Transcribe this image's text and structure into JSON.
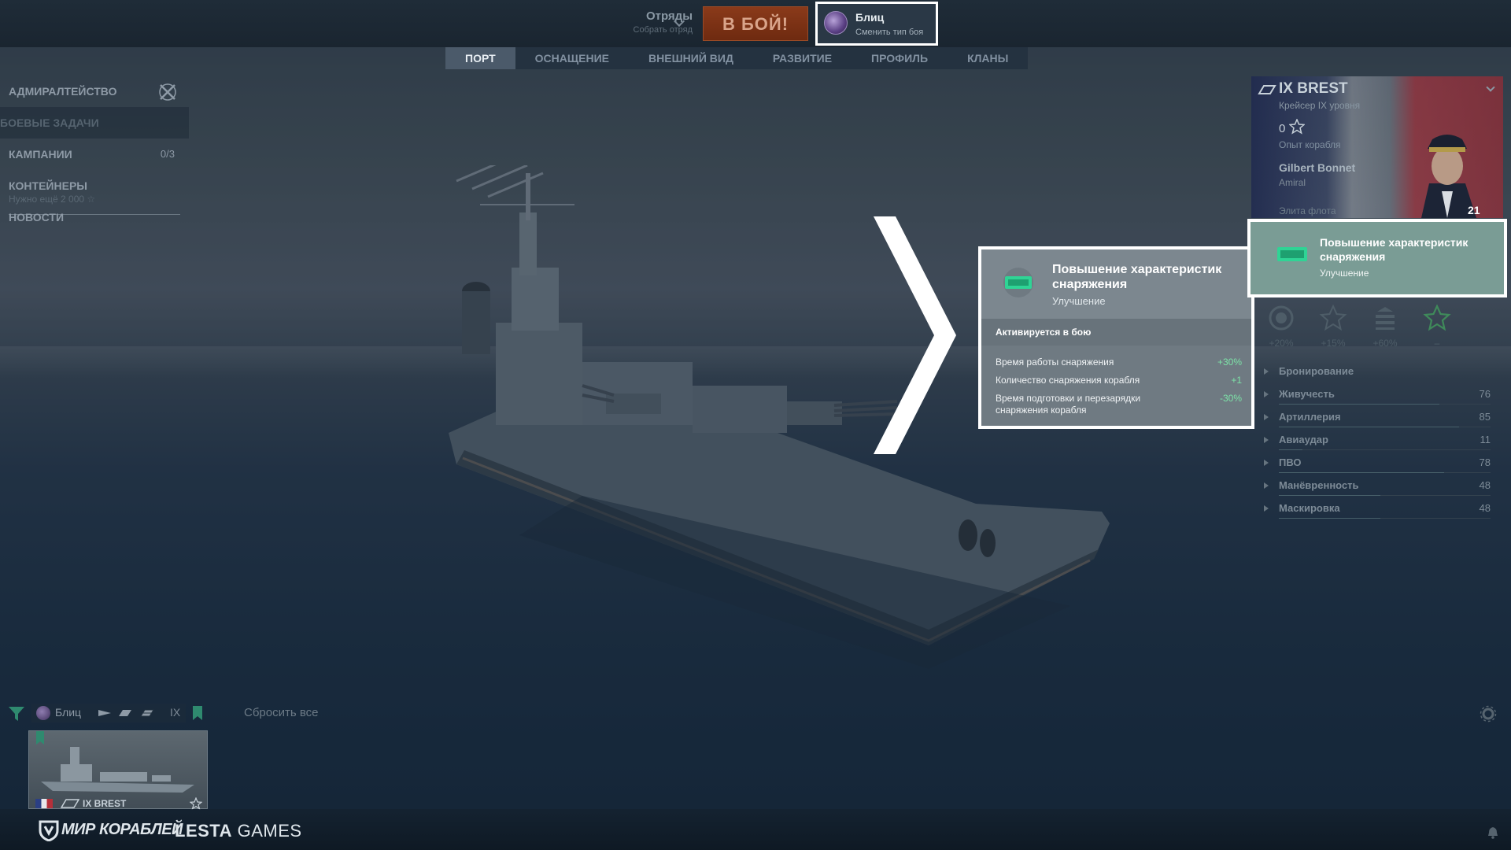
{
  "topbar": {
    "squads_title": "Отряды",
    "squads_sub": "Собрать отряд",
    "battle_button": "В БОЙ!",
    "mode_title": "Блиц",
    "mode_sub": "Сменить тип боя"
  },
  "tabs": [
    {
      "label": "ПОРТ",
      "active": true
    },
    {
      "label": "ОСНАЩЕНИЕ",
      "active": false
    },
    {
      "label": "ВНЕШНИЙ ВИД",
      "active": false
    },
    {
      "label": "РАЗВИТИЕ",
      "active": false
    },
    {
      "label": "ПРОФИЛЬ",
      "active": false
    },
    {
      "label": "КЛАНЫ",
      "active": false
    }
  ],
  "left_menu": {
    "admiralty": "АДМИРАЛТЕЙСТВО",
    "combat_missions": "БОЕВЫЕ ЗАДАЧИ",
    "campaigns": "КАМПАНИИ",
    "campaigns_count": "0/3",
    "containers": "КОНТЕЙНЕРЫ",
    "containers_sub": "Нужно ещё 2 000",
    "news": "НОВОСТИ"
  },
  "tooltip": {
    "title": "Повышение характеристик снаряжения",
    "type": "Улучшение",
    "condition": "Активируется в бою",
    "rows": [
      {
        "label": "Время работы снаряжения",
        "value": "+30%"
      },
      {
        "label": "Количество снаряжения корабля",
        "value": "+1"
      },
      {
        "label": "Время подготовки и перезарядки снаряжения корабля",
        "value": "-30%"
      }
    ]
  },
  "ship_panel": {
    "name": "IX BREST",
    "class": "Крейсер IX уровня",
    "xp": "0",
    "xp_label": "Опыт корабля",
    "commander_name": "Gilbert Bonnet",
    "commander_rank": "Amiral",
    "commander_elite": "Элита флота",
    "commander_level": "21"
  },
  "upgrade_slot": {
    "title": "Повышение характеристик снаряжения",
    "type": "Улучшение"
  },
  "bonus_slots": [
    "+20%",
    "+15%",
    "+60%",
    "–"
  ],
  "stats": [
    {
      "name": "Бронирование",
      "value": ""
    },
    {
      "name": "Живучесть",
      "value": "76"
    },
    {
      "name": "Артиллерия",
      "value": "85"
    },
    {
      "name": "Авиаудар",
      "value": "11"
    },
    {
      "name": "ПВО",
      "value": "78"
    },
    {
      "name": "Манёвренность",
      "value": "48"
    },
    {
      "name": "Маскировка",
      "value": "48"
    }
  ],
  "carousel": {
    "filter_mode": "Блиц",
    "filter_tier": "IX",
    "reset_all": "Сбросить все",
    "card_name": "IX BREST"
  },
  "footer": {
    "logo_mk": "МИР КОРАБЛЕЙ",
    "logo_lesta_a": "LESTA",
    "logo_lesta_b": "GAMES"
  },
  "colors": {
    "battle_button": "#8a3a1a",
    "positive_value": "#7de3a8",
    "highlight_border": "#ffffff",
    "upgrade_bg": "#7a9c95"
  }
}
